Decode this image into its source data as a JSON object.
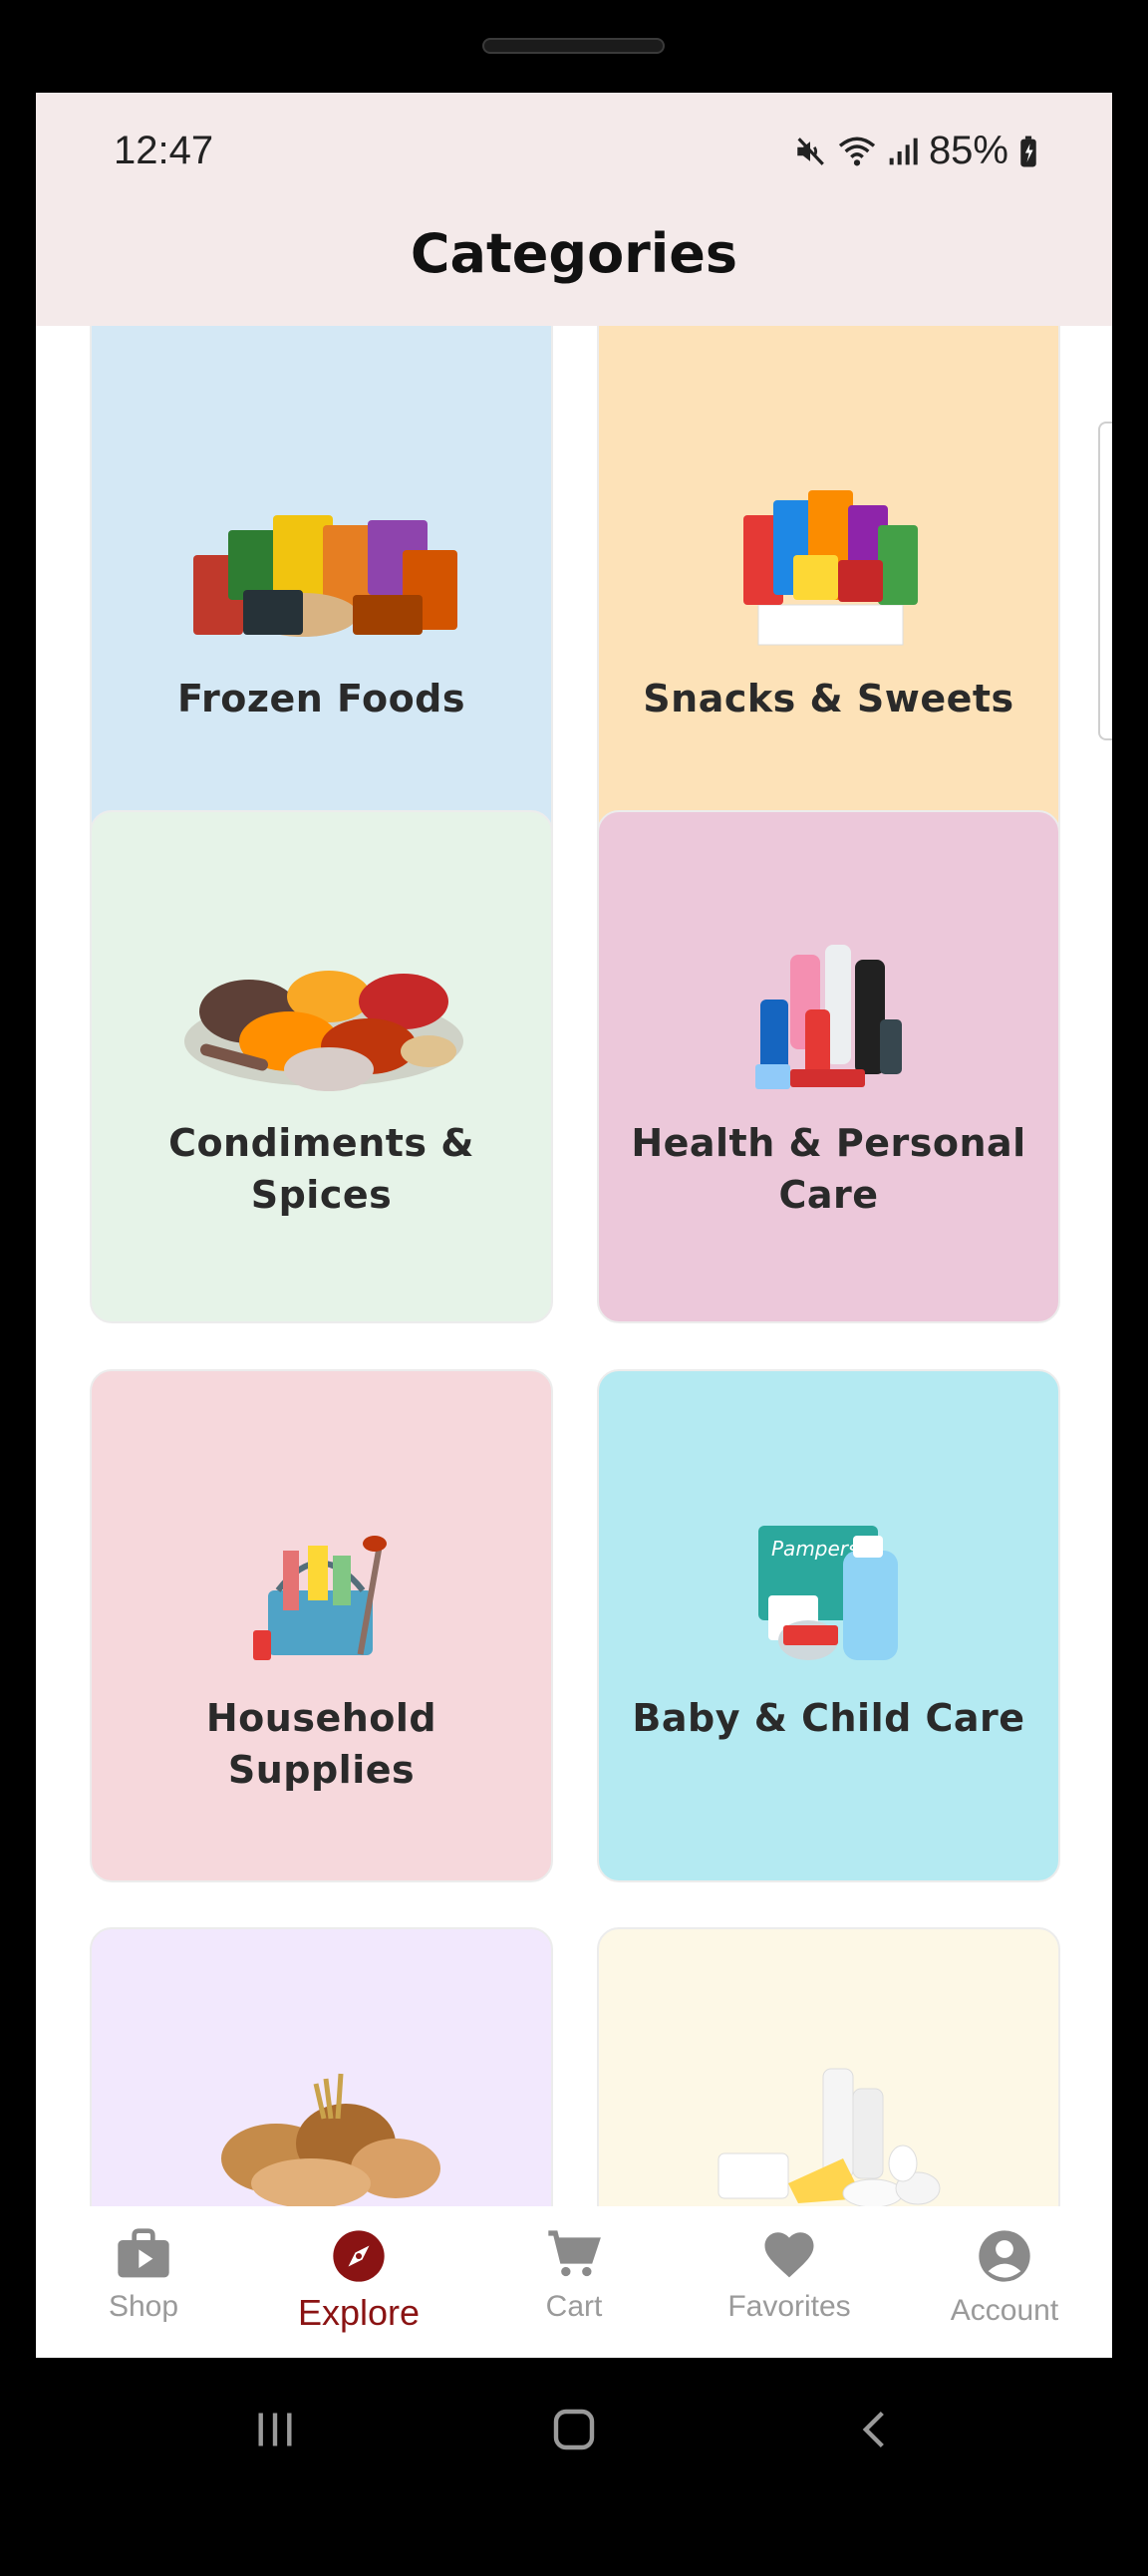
{
  "status": {
    "time": "12:47",
    "battery": "85%"
  },
  "header": {
    "title": "Categories"
  },
  "categories": [
    {
      "label": "Frozen Foods",
      "bg": "#d4e8f5"
    },
    {
      "label": "Snacks & Sweets",
      "bg": "#fde2b8"
    },
    {
      "label": "Condiments & Spices",
      "bg": "#e6f3e8"
    },
    {
      "label": "Health & Personal Care",
      "bg": "#ecc8da"
    },
    {
      "label": "Household Supplies",
      "bg": "#f6d8dc"
    },
    {
      "label": "Baby & Child Care",
      "bg": "#b4eaf2"
    },
    {
      "label": "",
      "bg": "#f2e8fd"
    },
    {
      "label": "",
      "bg": "#fdf8e6"
    }
  ],
  "nav": {
    "items": [
      {
        "label": "Shop",
        "icon": "shop-bag-icon"
      },
      {
        "label": "Explore",
        "icon": "compass-icon",
        "active": true
      },
      {
        "label": "Cart",
        "icon": "cart-icon"
      },
      {
        "label": "Favorites",
        "icon": "heart-icon"
      },
      {
        "label": "Account",
        "icon": "account-icon"
      }
    ],
    "active_color": "#8a1313",
    "inactive_color": "#9a9a9a"
  }
}
